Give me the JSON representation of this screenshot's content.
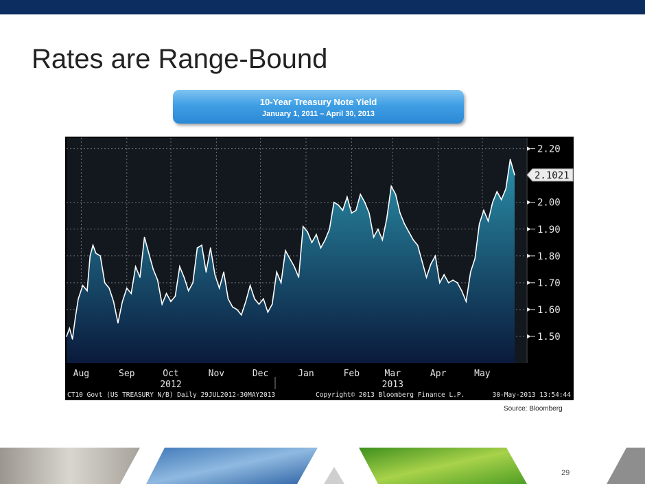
{
  "slide": {
    "title": "Rates are Range-Bound",
    "source": "Source: Bloomberg",
    "page_number": "29"
  },
  "callout": {
    "line1": "10-Year Treasury Note Yield",
    "line2": "January 1, 2011 – April 30, 2013"
  },
  "chart_data": {
    "type": "area",
    "x": [
      "2012-07-29",
      "2012-07-31",
      "2012-08-02",
      "2012-08-04",
      "2012-08-06",
      "2012-08-09",
      "2012-08-12",
      "2012-08-14",
      "2012-08-16",
      "2012-08-18",
      "2012-08-21",
      "2012-08-24",
      "2012-08-27",
      "2012-08-30",
      "2012-09-02",
      "2012-09-05",
      "2012-09-08",
      "2012-09-11",
      "2012-09-14",
      "2012-09-17",
      "2012-09-20",
      "2012-09-23",
      "2012-09-26",
      "2012-09-29",
      "2012-10-02",
      "2012-10-05",
      "2012-10-08",
      "2012-10-11",
      "2012-10-14",
      "2012-10-17",
      "2012-10-20",
      "2012-10-23",
      "2012-10-26",
      "2012-10-29",
      "2012-11-01",
      "2012-11-04",
      "2012-11-07",
      "2012-11-10",
      "2012-11-13",
      "2012-11-16",
      "2012-11-19",
      "2012-11-22",
      "2012-11-25",
      "2012-11-28",
      "2012-12-01",
      "2012-12-04",
      "2012-12-07",
      "2012-12-10",
      "2012-12-13",
      "2012-12-16",
      "2012-12-19",
      "2012-12-22",
      "2012-12-25",
      "2012-12-28",
      "2012-12-31",
      "2013-01-03",
      "2013-01-06",
      "2013-01-09",
      "2013-01-12",
      "2013-01-15",
      "2013-01-18",
      "2013-01-21",
      "2013-01-24",
      "2013-01-27",
      "2013-01-30",
      "2013-02-02",
      "2013-02-05",
      "2013-02-08",
      "2013-02-11",
      "2013-02-14",
      "2013-02-17",
      "2013-02-20",
      "2013-02-23",
      "2013-02-26",
      "2013-03-01",
      "2013-03-04",
      "2013-03-07",
      "2013-03-10",
      "2013-03-13",
      "2013-03-16",
      "2013-03-19",
      "2013-03-22",
      "2013-03-25",
      "2013-03-28",
      "2013-03-31",
      "2013-04-03",
      "2013-04-06",
      "2013-04-09",
      "2013-04-12",
      "2013-04-15",
      "2013-04-18",
      "2013-04-21",
      "2013-04-24",
      "2013-04-27",
      "2013-04-30",
      "2013-05-03",
      "2013-05-06",
      "2013-05-09",
      "2013-05-12",
      "2013-05-15",
      "2013-05-18",
      "2013-05-21",
      "2013-05-24",
      "2013-05-27",
      "2013-05-30"
    ],
    "values": [
      1.5,
      1.53,
      1.49,
      1.57,
      1.64,
      1.69,
      1.67,
      1.8,
      1.84,
      1.81,
      1.8,
      1.7,
      1.68,
      1.63,
      1.55,
      1.63,
      1.68,
      1.66,
      1.76,
      1.72,
      1.87,
      1.81,
      1.75,
      1.71,
      1.62,
      1.66,
      1.63,
      1.65,
      1.76,
      1.72,
      1.67,
      1.7,
      1.83,
      1.84,
      1.74,
      1.83,
      1.73,
      1.68,
      1.74,
      1.64,
      1.61,
      1.6,
      1.58,
      1.63,
      1.69,
      1.64,
      1.62,
      1.64,
      1.59,
      1.62,
      1.74,
      1.7,
      1.82,
      1.79,
      1.76,
      1.72,
      1.91,
      1.89,
      1.85,
      1.88,
      1.83,
      1.86,
      1.9,
      2.0,
      1.99,
      1.97,
      2.02,
      1.96,
      1.97,
      2.03,
      2.0,
      1.96,
      1.87,
      1.9,
      1.86,
      1.94,
      2.06,
      2.03,
      1.96,
      1.92,
      1.89,
      1.86,
      1.84,
      1.78,
      1.72,
      1.77,
      1.8,
      1.7,
      1.73,
      1.7,
      1.71,
      1.7,
      1.67,
      1.63,
      1.74,
      1.79,
      1.92,
      1.97,
      1.93,
      2.0,
      2.04,
      2.01,
      2.05,
      2.16,
      2.1021
    ],
    "xlabel": "",
    "ylabel": "",
    "ylim": [
      1.4,
      2.24
    ],
    "y_ticks": [
      "2.20",
      "2.00",
      "1.90",
      "1.80",
      "1.70",
      "1.60",
      "1.50"
    ],
    "x_ticks": [
      {
        "label": "Aug",
        "date": "2012-08-08"
      },
      {
        "label": "Sep",
        "date": "2012-09-08"
      },
      {
        "label": "Oct",
        "date": "2012-10-08"
      },
      {
        "label": "Nov",
        "date": "2012-11-08"
      },
      {
        "label": "Dec",
        "date": "2012-12-08"
      },
      {
        "label": "Jan",
        "date": "2013-01-08"
      },
      {
        "label": "Feb",
        "date": "2013-02-08"
      },
      {
        "label": "Mar",
        "date": "2013-03-08"
      },
      {
        "label": "Apr",
        "date": "2013-04-08"
      },
      {
        "label": "May",
        "date": "2013-05-08"
      }
    ],
    "year_labels": [
      {
        "label": "2012",
        "date": "2012-10-08"
      },
      {
        "label": "2013",
        "date": "2013-03-08"
      }
    ],
    "last_value_label": "2.1021",
    "footer_left": "CT10 Govt (US TREASURY N/B) Daily 29JUL2012-30MAY2013",
    "footer_mid": "Copyright© 2013 Bloomberg Finance L.P.",
    "footer_right": "30-May-2013 13:54:44",
    "grid": true,
    "colors": {
      "line": "#ffffff",
      "fill_top": "#2a8fa8",
      "fill_bottom": "#0a1a3c",
      "background": "#000000",
      "plot_bg": "#12181e",
      "grid": "#6c7378"
    }
  }
}
